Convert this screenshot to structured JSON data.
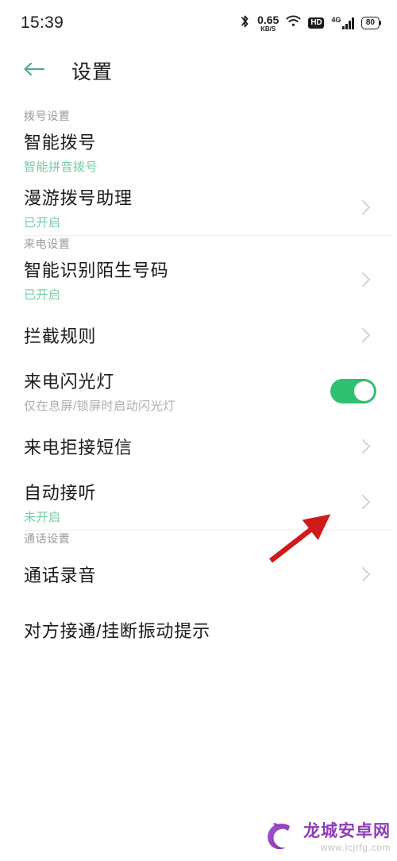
{
  "status_bar": {
    "time": "15:39",
    "bluetooth_icon": "bluetooth-icon",
    "network_speed_value": "0.65",
    "network_speed_unit": "KB/S",
    "wifi_icon": "wifi-icon",
    "hd_label": "HD",
    "network_type": "4G",
    "signal_icon": "signal-bars-icon",
    "battery_level": "80"
  },
  "app_bar": {
    "back_icon": "back-arrow-icon",
    "title": "设置"
  },
  "colors": {
    "accent_green": "#72cda2",
    "toggle_on": "#2fc071",
    "back_arrow": "#4aab80",
    "annotation_red": "#d11a1a",
    "watermark_purple": "#8b35b5"
  },
  "sections": [
    {
      "label": "拨号设置",
      "items": [
        {
          "title": "智能拨号",
          "subtitle": "智能拼音拨号",
          "subtitle_style": "green",
          "control": "none"
        },
        {
          "title": "漫游拨号助理",
          "subtitle": "已开启",
          "subtitle_style": "green",
          "control": "chevron"
        }
      ]
    },
    {
      "label": "来电设置",
      "items": [
        {
          "title": "智能识别陌生号码",
          "subtitle": "已开启",
          "subtitle_style": "green",
          "control": "chevron"
        },
        {
          "title": "拦截规则",
          "subtitle": "",
          "subtitle_style": "none",
          "control": "chevron"
        },
        {
          "title": "来电闪光灯",
          "subtitle": "仅在息屏/锁屏时启动闪光灯",
          "subtitle_style": "grey",
          "control": "toggle",
          "toggle_on": true
        },
        {
          "title": "来电拒接短信",
          "subtitle": "",
          "subtitle_style": "none",
          "control": "chevron"
        },
        {
          "title": "自动接听",
          "subtitle": "未开启",
          "subtitle_style": "green",
          "control": "chevron"
        }
      ]
    },
    {
      "label": "通话设置",
      "items": [
        {
          "title": "通话录音",
          "subtitle": "",
          "subtitle_style": "none",
          "control": "chevron"
        },
        {
          "title": "对方接通/挂断振动提示",
          "subtitle": "",
          "subtitle_style": "none",
          "control": "none"
        }
      ]
    }
  ],
  "annotation": {
    "type": "arrow",
    "points_to": "来电闪光灯 toggle"
  },
  "watermark": {
    "name": "龙城安卓网",
    "url": "www.lcjrfg.com",
    "logo_icon": "dragon-logo-icon"
  }
}
